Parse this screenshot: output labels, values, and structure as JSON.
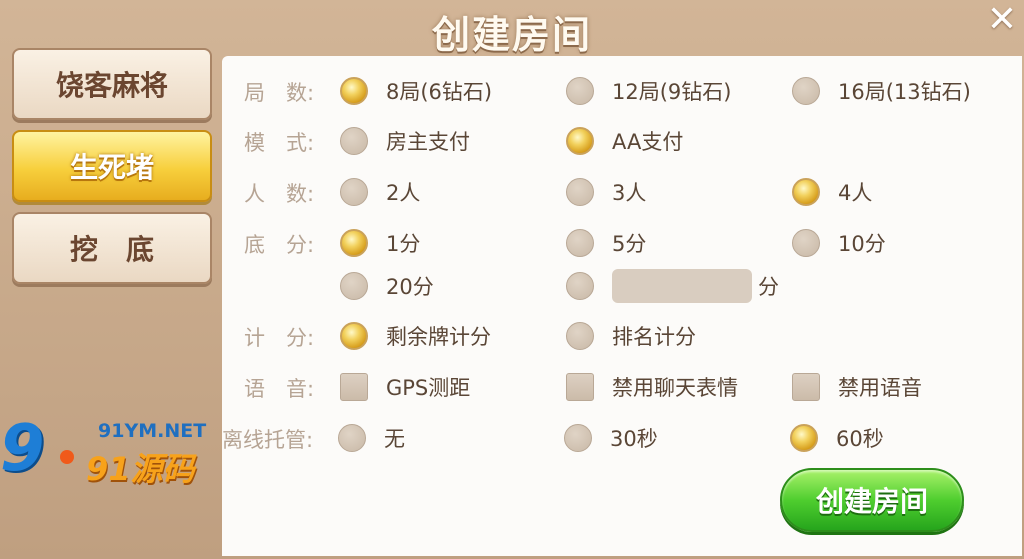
{
  "title": "创建房间",
  "close_label": "✕",
  "tabs": [
    {
      "label": "饶客麻将",
      "selected": false
    },
    {
      "label": "生死堵",
      "selected": true
    },
    {
      "label": "挖　底",
      "selected": false
    }
  ],
  "rows": {
    "rounds": {
      "label": "局　数:",
      "options": [
        {
          "label": "8局(6钻石)",
          "selected": true
        },
        {
          "label": "12局(9钻石)",
          "selected": false
        },
        {
          "label": "16局(13钻石)",
          "selected": false
        }
      ]
    },
    "mode": {
      "label": "模　式:",
      "options": [
        {
          "label": "房主支付",
          "selected": false
        },
        {
          "label": "AA支付",
          "selected": true
        }
      ]
    },
    "players": {
      "label": "人　数:",
      "options": [
        {
          "label": "2人",
          "selected": false
        },
        {
          "label": "3人",
          "selected": false
        },
        {
          "label": "4人",
          "selected": true
        }
      ]
    },
    "base_score": {
      "label": "底　分:",
      "options": [
        {
          "label": "1分",
          "selected": true
        },
        {
          "label": "5分",
          "selected": false
        },
        {
          "label": "10分",
          "selected": false
        },
        {
          "label": "20分",
          "selected": false
        }
      ],
      "custom_suffix": "分",
      "custom_value": ""
    },
    "scoring": {
      "label": "计　分:",
      "options": [
        {
          "label": "剩余牌计分",
          "selected": true
        },
        {
          "label": "排名计分",
          "selected": false
        }
      ]
    },
    "voice": {
      "label": "语　音:",
      "options": [
        {
          "label": "GPS测距",
          "checked": false
        },
        {
          "label": "禁用聊天表情",
          "checked": false
        },
        {
          "label": "禁用语音",
          "checked": false
        }
      ]
    },
    "offline": {
      "label": "离线托管:",
      "options": [
        {
          "label": "无",
          "selected": false
        },
        {
          "label": "30秒",
          "selected": false
        },
        {
          "label": "60秒",
          "selected": true
        }
      ]
    }
  },
  "create_button": "创建房间",
  "watermark": {
    "num": "9",
    "site": "91YM.NET",
    "brand": "91源码"
  },
  "colors": {
    "accent_gold": "#f2c53a",
    "button_green": "#4fce2f",
    "panel": "#fcfbf9"
  }
}
